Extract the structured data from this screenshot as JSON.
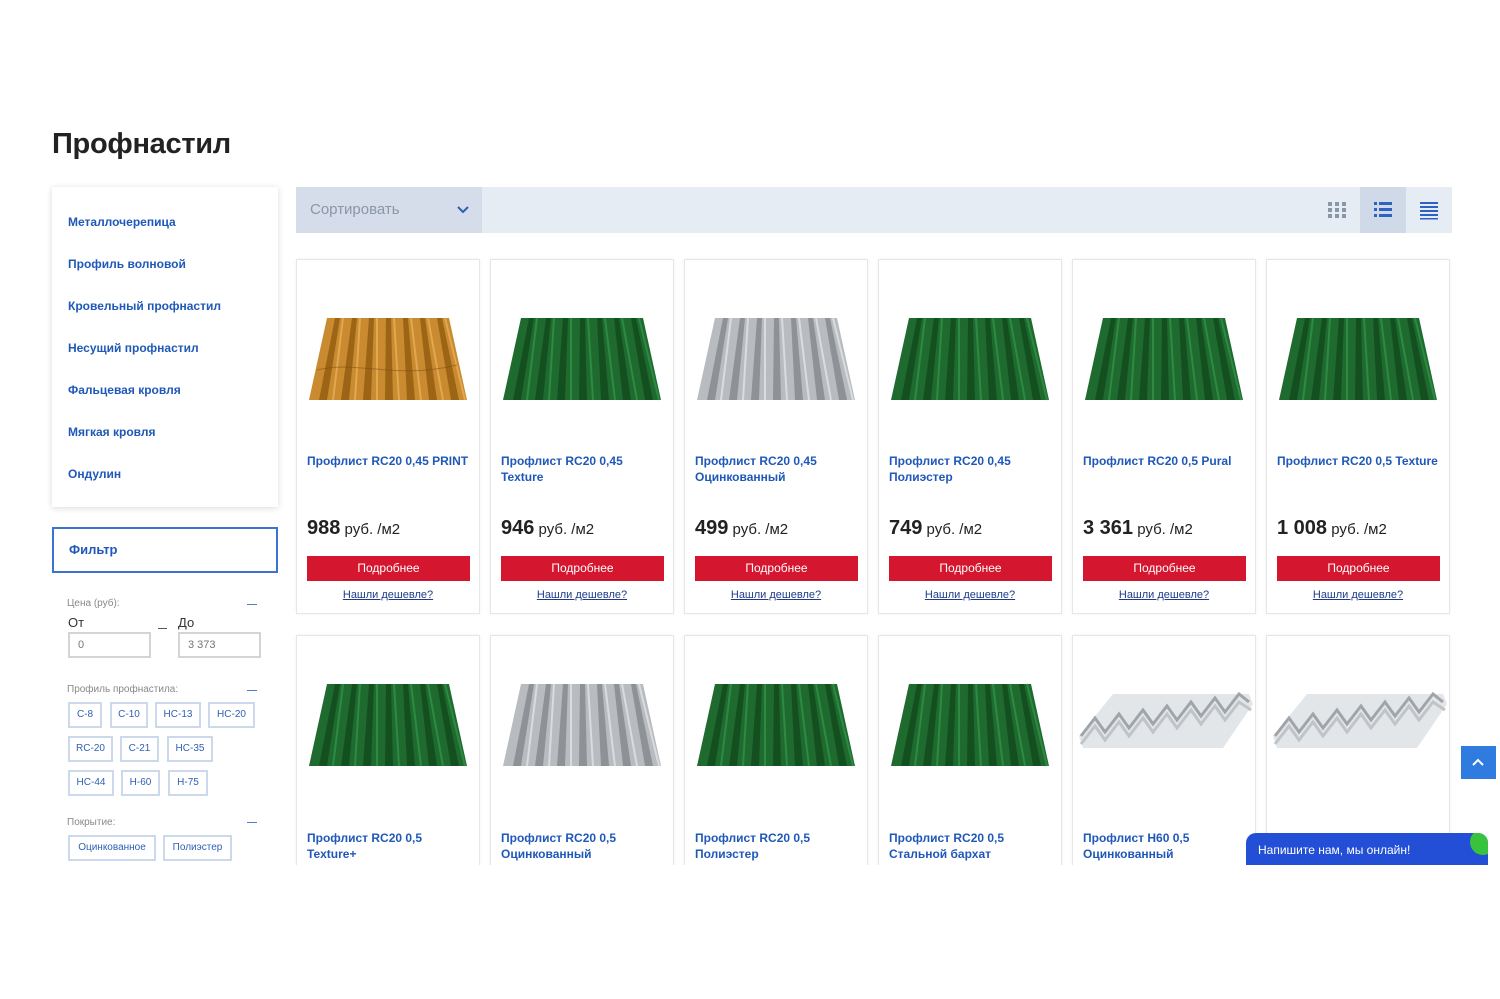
{
  "page": {
    "title": "Профнастил"
  },
  "categories": [
    "Металлочерепица",
    "Профиль волновой",
    "Кровельный профнастил",
    "Несущий профнастил",
    "Фальцевая кровля",
    "Мягкая кровля",
    "Ондулин"
  ],
  "filter": {
    "title": "Фильтр",
    "price": {
      "label": "Цена (руб):",
      "from_label": "От",
      "to_label": "До",
      "from_placeholder": "0",
      "to_placeholder": "3 373"
    },
    "profile": {
      "label": "Профиль профнастила:",
      "options": [
        "С-8",
        "С-10",
        "НС-13",
        "НС-20",
        "RC-20",
        "С-21",
        "НС-35",
        "НС-44",
        "Н-60",
        "Н-75"
      ]
    },
    "coating": {
      "label": "Покрытие:",
      "options": [
        "Оцинкованное",
        "Полиэстер"
      ]
    }
  },
  "toolbar": {
    "sort_label": "Сортировать",
    "views": [
      "grid-view-icon",
      "list-view-icon",
      "table-view-icon"
    ],
    "active_view": "list-view-icon"
  },
  "products": [
    {
      "name": "Профлист RC20 0,45 PRINT",
      "price": "988",
      "unit": " руб. /м2",
      "image": "wood-sheet",
      "more": "Подробнее",
      "cheaper": "Нашли дешевле?"
    },
    {
      "name": "Профлист RC20 0,45 Texture",
      "price": "946",
      "unit": " руб. /м2",
      "image": "green-sheet",
      "more": "Подробнее",
      "cheaper": "Нашли дешевле?"
    },
    {
      "name": "Профлист RC20 0,45 Оцинкованный",
      "price": "499",
      "unit": " руб. /м2",
      "image": "grey-sheet",
      "more": "Подробнее",
      "cheaper": "Нашли дешевле?"
    },
    {
      "name": "Профлист RC20 0,45 Полиэстер",
      "price": "749",
      "unit": " руб. /м2",
      "image": "green-sheet",
      "more": "Подробнее",
      "cheaper": "Нашли дешевле?"
    },
    {
      "name": "Профлист RC20 0,5 Pural",
      "price": "3 361",
      "unit": " руб. /м2",
      "image": "green-sheet",
      "more": "Подробнее",
      "cheaper": "Нашли дешевле?"
    },
    {
      "name": "Профлист RC20 0,5 Texture",
      "price": "1 008",
      "unit": " руб. /м2",
      "image": "green-sheet",
      "more": "Подробнее",
      "cheaper": "Нашли дешевле?"
    },
    {
      "name": "Профлист RC20 0,5 Texture+",
      "image": "green-sheet"
    },
    {
      "name": "Профлист RC20 0,5 Оцинкованный",
      "image": "grey-sheet"
    },
    {
      "name": "Профлист RC20 0,5 Полиэстер",
      "image": "green-sheet"
    },
    {
      "name": "Профлист RC20 0,5 Стальной бархат",
      "image": "green-sheet"
    },
    {
      "name": "Профлист Н60 0,5 Оцинкованный",
      "image": "deck-sheet"
    },
    {
      "name": "",
      "image": "deck-sheet"
    }
  ],
  "chat": {
    "text": "Напишите нам, мы онлайн!"
  },
  "colors": {
    "accent": "#1f58b8",
    "button": "#d4162f",
    "toolbar": "#e6ecf4"
  }
}
